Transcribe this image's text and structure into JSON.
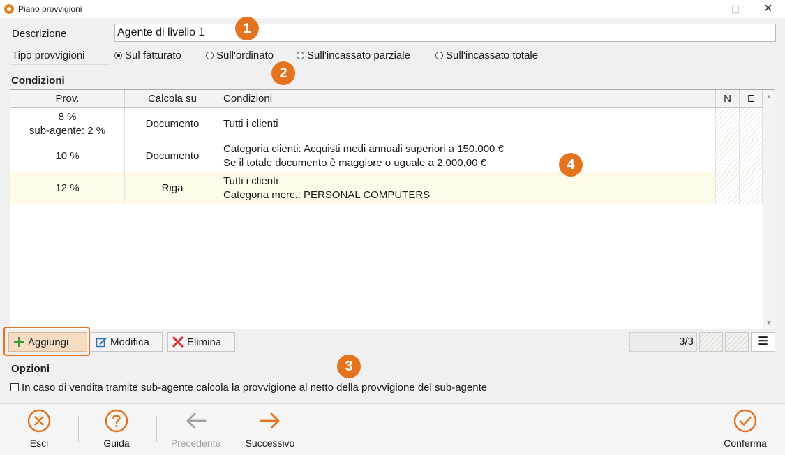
{
  "window": {
    "title": "Piano provvigioni",
    "min_glyph": "—",
    "max_glyph": "☐",
    "close_glyph": "✕"
  },
  "form": {
    "descrizione_label": "Descrizione",
    "descrizione_value": "Agente di livello 1",
    "tipo_label": "Tipo provvigioni",
    "tipo_options": [
      {
        "label": "Sul fatturato",
        "selected": true
      },
      {
        "label": "Sull'ordinato",
        "selected": false
      },
      {
        "label": "Sull'incassato parziale",
        "selected": false
      },
      {
        "label": "Sull'incassato totale",
        "selected": false
      }
    ]
  },
  "callouts": [
    "1",
    "2",
    "3",
    "4"
  ],
  "conditions": {
    "title": "Condizioni",
    "columns": {
      "prov": "Prov.",
      "calc": "Calcola su",
      "cond": "Condizioni",
      "n": "N",
      "e": "E"
    },
    "rows": [
      {
        "prov1": "8 %",
        "prov2": "sub-agente: 2 %",
        "calc": "Documento",
        "cond1": "Tutti i clienti",
        "cond2": "",
        "selected": false
      },
      {
        "prov1": "10 %",
        "prov2": "",
        "calc": "Documento",
        "cond1": "Categoria clienti: Acquisti medi annuali superiori a 150.000 €",
        "cond2": "Se il totale documento è maggiore o uguale a 2.000,00 €",
        "selected": false
      },
      {
        "prov1": "12 %",
        "prov2": "",
        "calc": "Riga",
        "cond1": "Tutti i clienti",
        "cond2": "Categoria merc.: PERSONAL COMPUTERS",
        "selected": true
      }
    ]
  },
  "toolbar": {
    "add_label": "Aggiungi",
    "edit_label": "Modifica",
    "delete_label": "Elimina",
    "counter": "3/3",
    "menu_glyph": "☰"
  },
  "options": {
    "title": "Opzioni",
    "checkbox_label": "In caso di vendita tramite sub-agente calcola la provvigione al netto della provvigione del sub-agente",
    "checked": false
  },
  "bottom": {
    "esci": "Esci",
    "guida": "Guida",
    "precedente": "Precedente",
    "successivo": "Successivo",
    "conferma": "Conferma"
  },
  "colors": {
    "accent": "#e5731d",
    "selected_row": "#fdfbe8",
    "disabled": "#a0a0a0"
  }
}
